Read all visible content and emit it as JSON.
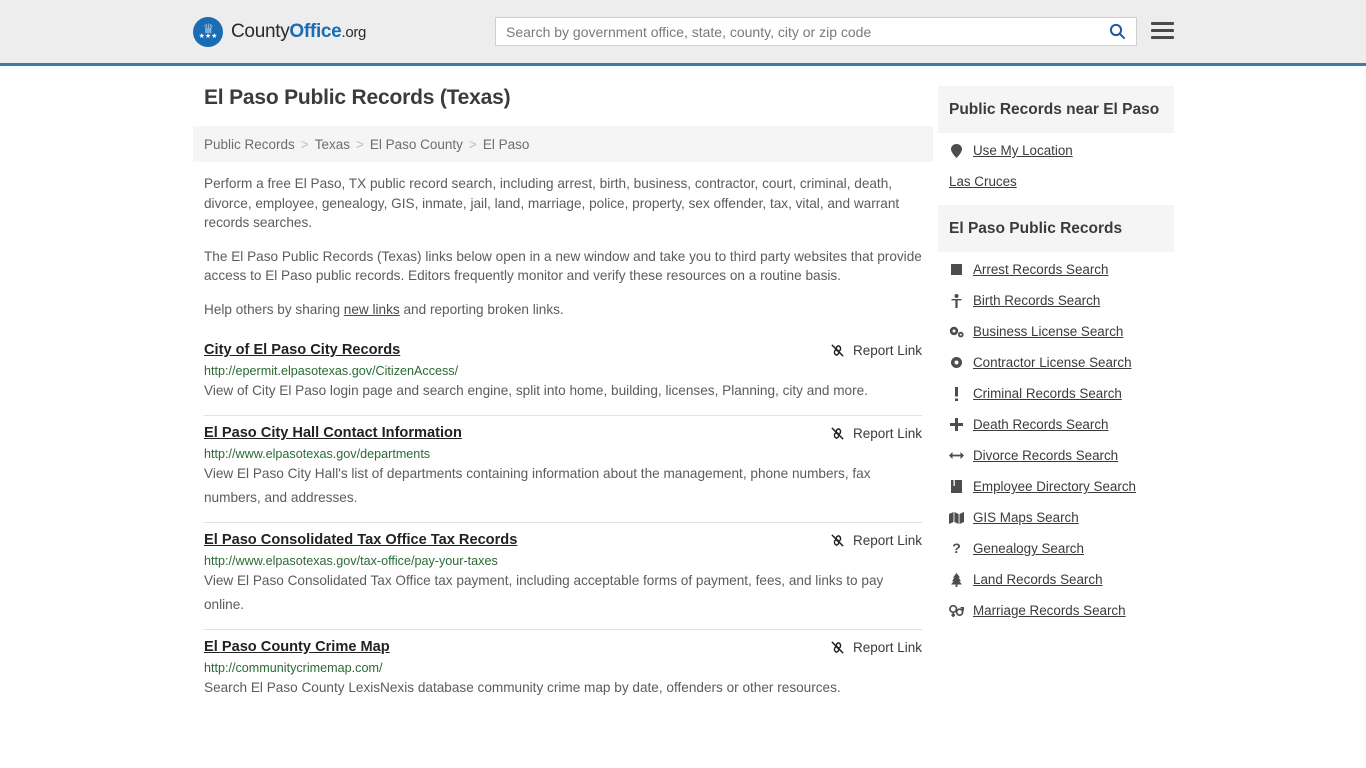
{
  "header": {
    "brand": {
      "part1": "County",
      "part2": "Office",
      "part3": ".org",
      "logo_icon": "eagle-seal-icon"
    },
    "search": {
      "placeholder": "Search by government office, state, county, city or zip code",
      "value": ""
    },
    "search_icon": "search-icon",
    "menu_icon": "hamburger-menu-icon",
    "accent_color": "#3b7ca8"
  },
  "main": {
    "title": "El Paso Public Records (Texas)",
    "breadcrumb": [
      {
        "label": "Public Records"
      },
      {
        "label": "Texas"
      },
      {
        "label": "El Paso County"
      },
      {
        "label": "El Paso"
      }
    ],
    "breadcrumb_separator": ">",
    "intro": {
      "p1": "Perform a free El Paso, TX public record search, including arrest, birth, business, contractor, court, criminal, death, divorce, employee, genealogy, GIS, inmate, jail, land, marriage, police, property, sex offender, tax, vital, and warrant records searches.",
      "p2": "The El Paso Public Records (Texas) links below open in a new window and take you to third party websites that provide access to El Paso public records. Editors frequently monitor and verify these resources on a routine basis.",
      "p3_before": "Help others by sharing ",
      "p3_link": "new links",
      "p3_after": " and reporting broken links."
    },
    "report_link_label": "Report Link",
    "report_link_icon": "broken-link-icon",
    "results": [
      {
        "title": "City of El Paso City Records",
        "url": "http://epermit.elpasotexas.gov/CitizenAccess/",
        "description": "View of City El Paso login page and search engine, split into home, building, licenses, Planning, city and more."
      },
      {
        "title": "El Paso City Hall Contact Information",
        "url": "http://www.elpasotexas.gov/departments",
        "description": "View El Paso City Hall's list of departments containing information about the management, phone numbers, fax numbers, and addresses."
      },
      {
        "title": "El Paso Consolidated Tax Office Tax Records",
        "url": "http://www.elpasotexas.gov/tax-office/pay-your-taxes",
        "description": "View El Paso Consolidated Tax Office tax payment, including acceptable forms of payment, fees, and links to pay online."
      },
      {
        "title": "El Paso County Crime Map",
        "url": "http://communitycrimemap.com/",
        "description": "Search El Paso County LexisNexis database community crime map by date, offenders or other resources."
      }
    ]
  },
  "sidebar": {
    "near_box": {
      "title": "Public Records near El Paso",
      "use_my_location": {
        "label": "Use My Location",
        "icon": "map-pin-icon"
      },
      "places": [
        {
          "label": "Las Cruces"
        }
      ]
    },
    "records_box": {
      "title": "El Paso Public Records",
      "items": [
        {
          "label": "Arrest Records Search",
          "icon": "square-icon",
          "glyph": "■"
        },
        {
          "label": "Birth Records Search",
          "icon": "baby-icon",
          "glyph": "ί"
        },
        {
          "label": "Business License Search",
          "icon": "cogs-icon",
          "glyph": "⚙"
        },
        {
          "label": "Contractor License Search",
          "icon": "gear-icon",
          "glyph": "⚙"
        },
        {
          "label": "Criminal Records Search",
          "icon": "exclamation-icon",
          "glyph": "!"
        },
        {
          "label": "Death Records Search",
          "icon": "plus-cross-icon",
          "glyph": "✚"
        },
        {
          "label": "Divorce Records Search",
          "icon": "arrows-horizontal-icon",
          "glyph": "↔"
        },
        {
          "label": "Employee Directory Search",
          "icon": "book-icon",
          "glyph": "▮"
        },
        {
          "label": "GIS Maps Search",
          "icon": "map-icon",
          "glyph": "☷"
        },
        {
          "label": "Genealogy Search",
          "icon": "question-mark-icon",
          "glyph": "?"
        },
        {
          "label": "Land Records Search",
          "icon": "tree-icon",
          "glyph": "♣"
        },
        {
          "label": "Marriage Records Search",
          "icon": "venus-mars-icon",
          "glyph": "⚥"
        }
      ]
    }
  }
}
